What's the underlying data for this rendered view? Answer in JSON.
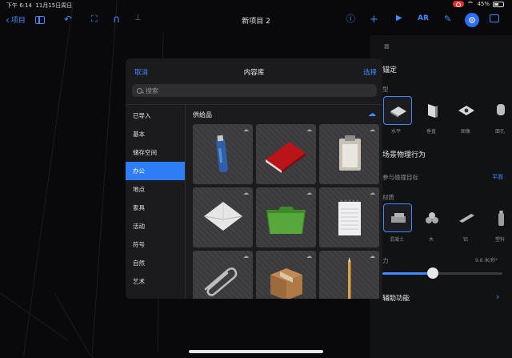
{
  "status_bar": {
    "time": "下午 6:14",
    "date": "11月15日周日",
    "battery": "45%"
  },
  "toolbar": {
    "back_label": "项目",
    "document_title": "新项目 2",
    "ar_label": "AR"
  },
  "inspector": {
    "header_partial": "器",
    "anchor_label": "锚定",
    "type_label": "型",
    "anchor_types": [
      "水平",
      "垂直",
      "图像",
      "面孔"
    ],
    "physics_label": "场景物理行为",
    "participates_label": "参与碰撞目标",
    "participates_value": "平面",
    "material_label": "材质",
    "materials": [
      "混凝土",
      "木",
      "铝",
      "塑料"
    ],
    "gravity_label": "力",
    "gravity_value": "9.8 米/秒²",
    "gravity_fraction": 0.42,
    "accessibility_label": "辅助功能"
  },
  "library": {
    "cancel": "取消",
    "title": "内容库",
    "select": "选择",
    "search_placeholder": "搜索",
    "section_title": "供给品",
    "categories": [
      "已导入",
      "基本",
      "储存空间",
      "办公",
      "地点",
      "家具",
      "活动",
      "符号",
      "自然",
      "艺术"
    ],
    "active_category": "办公",
    "items": [
      {
        "icon": "usb-drive-icon"
      },
      {
        "icon": "red-book-icon"
      },
      {
        "icon": "clipboard-icon"
      },
      {
        "icon": "envelope-icon"
      },
      {
        "icon": "green-folder-icon"
      },
      {
        "icon": "notepad-icon"
      },
      {
        "icon": "paperclip-icon"
      },
      {
        "icon": "cardboard-box-icon"
      },
      {
        "icon": "pencil-icon"
      }
    ]
  },
  "colors": {
    "accent": "#3d8bff",
    "active_category_bg": "#2e7cf6",
    "record": "#e5322e"
  }
}
